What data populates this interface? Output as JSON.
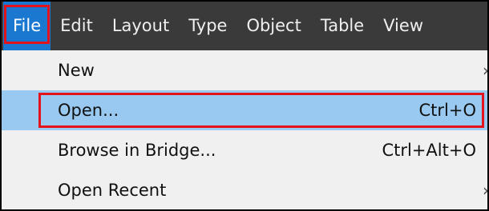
{
  "menubar": {
    "items": [
      {
        "label": "File"
      },
      {
        "label": "Edit"
      },
      {
        "label": "Layout"
      },
      {
        "label": "Type"
      },
      {
        "label": "Object"
      },
      {
        "label": "Table"
      },
      {
        "label": "View"
      }
    ],
    "active_item": "File"
  },
  "file_menu": {
    "items": [
      {
        "label": "New",
        "shortcut": "",
        "submenu_arrow": "›"
      },
      {
        "label": "Open...",
        "shortcut": "Ctrl+O"
      },
      {
        "label": "Browse in Bridge...",
        "shortcut": "Ctrl+Alt+O"
      },
      {
        "label": "Open Recent",
        "shortcut": "",
        "submenu_arrow": "›"
      }
    ],
    "highlighted_item": "Open..."
  },
  "colors": {
    "menubar_background": "#3a3a3a",
    "active_menu_background": "#1b78d0",
    "highlight_background": "#99c9f1",
    "annotation_outline": "#e3121b"
  }
}
